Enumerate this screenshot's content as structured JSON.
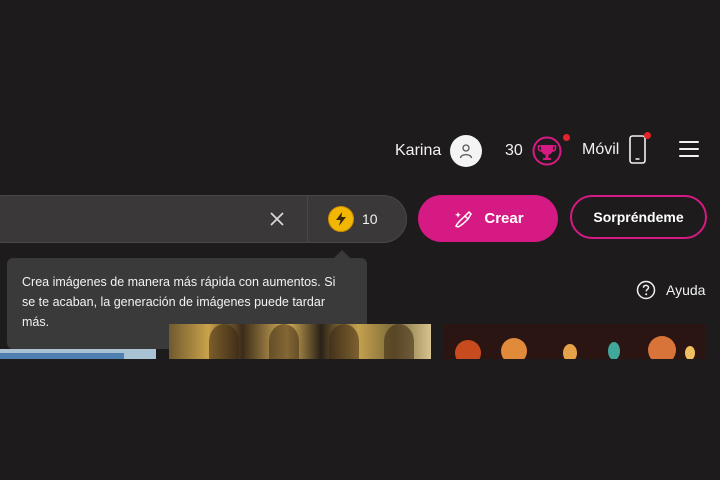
{
  "header": {
    "user_name": "Karina",
    "reward_count": "30",
    "mobile_label": "Móvil"
  },
  "search": {
    "value": "",
    "boost_count": "10"
  },
  "actions": {
    "create_label": "Crear",
    "surprise_label": "Sorpréndeme"
  },
  "tooltip": {
    "text": "Crea imágenes de manera más rápida con aumentos. Si se te acaban, la generación de imágenes puede tardar más."
  },
  "help": {
    "label": "Ayuda"
  },
  "colors": {
    "background": "#1d1b1b",
    "accent": "#d61a84",
    "notification_dot": "#e3242b",
    "boost_coin": "#f2b705"
  },
  "icons": {
    "avatar": "user-icon",
    "rewards": "trophy-icon",
    "mobile": "phone-icon",
    "menu": "menu-icon",
    "clear": "close-icon",
    "boost": "lightning-icon",
    "create": "sparkle-brush-icon",
    "help": "help-icon"
  }
}
